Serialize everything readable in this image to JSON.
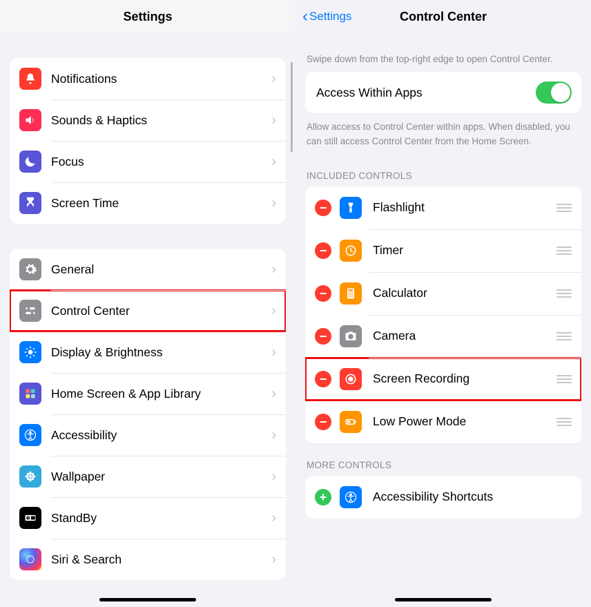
{
  "left": {
    "title": "Settings",
    "groups": [
      {
        "items": [
          {
            "label": "Notifications",
            "icon": "bell",
            "color": "ic-red"
          },
          {
            "label": "Sounds & Haptics",
            "icon": "speaker",
            "color": "ic-pink"
          },
          {
            "label": "Focus",
            "icon": "moon",
            "color": "ic-indigo"
          },
          {
            "label": "Screen Time",
            "icon": "hourglass",
            "color": "ic-indigo"
          }
        ]
      },
      {
        "items": [
          {
            "label": "General",
            "icon": "gear",
            "color": "ic-gray"
          },
          {
            "label": "Control Center",
            "icon": "sliders",
            "color": "ic-gray",
            "highlight": true
          },
          {
            "label": "Display & Brightness",
            "icon": "sun",
            "color": "ic-blue"
          },
          {
            "label": "Home Screen & App Library",
            "icon": "grid",
            "color": "ic-indigo"
          },
          {
            "label": "Accessibility",
            "icon": "person",
            "color": "ic-blue"
          },
          {
            "label": "Wallpaper",
            "icon": "flower",
            "color": "ic-lblue"
          },
          {
            "label": "StandBy",
            "icon": "clock-card",
            "color": "ic-black"
          },
          {
            "label": "Siri & Search",
            "icon": "siri",
            "color": "ic-siri"
          }
        ]
      }
    ]
  },
  "right": {
    "back_label": "Settings",
    "title": "Control Center",
    "helper_top": "Swipe down from the top-right edge to open Control Center.",
    "access_row": {
      "label": "Access Within Apps",
      "on": true
    },
    "helper_access": "Allow access to Control Center within apps. When disabled, you can still access Control Center from the Home Screen.",
    "included_header": "INCLUDED CONTROLS",
    "included": [
      {
        "label": "Flashlight",
        "icon": "flashlight",
        "color": "ic-blue"
      },
      {
        "label": "Timer",
        "icon": "timer",
        "color": "ic-orange"
      },
      {
        "label": "Calculator",
        "icon": "calculator",
        "color": "ic-orange"
      },
      {
        "label": "Camera",
        "icon": "camera",
        "color": "ic-gray"
      },
      {
        "label": "Screen Recording",
        "icon": "record",
        "color": "ic-red",
        "highlight": true
      },
      {
        "label": "Low Power Mode",
        "icon": "battery",
        "color": "ic-orange"
      }
    ],
    "more_header": "MORE CONTROLS",
    "more": [
      {
        "label": "Accessibility Shortcuts",
        "icon": "person",
        "color": "ic-blue"
      }
    ]
  }
}
